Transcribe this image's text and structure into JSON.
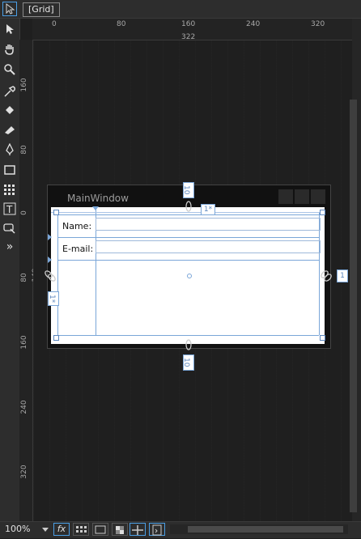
{
  "breadcrumb": {
    "label": "[Grid]"
  },
  "toolbox": {
    "tools": [
      {
        "name": "selection-tool-icon"
      },
      {
        "name": "pan-tool-icon"
      },
      {
        "name": "zoom-tool-icon"
      },
      {
        "name": "eyedropper-tool-icon"
      },
      {
        "name": "paint-bucket-tool-icon"
      },
      {
        "name": "eraser-tool-icon"
      },
      {
        "name": "pen-tool-icon"
      },
      {
        "name": "rectangle-tool-icon"
      },
      {
        "name": "grid-tool-icon"
      },
      {
        "name": "text-tool-icon"
      },
      {
        "name": "shape-tool-icon"
      },
      {
        "name": "expand-tool-icon"
      }
    ],
    "expand_label": "»"
  },
  "rulers": {
    "top": [
      "0",
      "80",
      "160",
      "240",
      "320"
    ],
    "top_span": "322",
    "left": [
      "160",
      "80",
      "0",
      "80",
      "160",
      "240",
      "320"
    ],
    "left_span": "149"
  },
  "window": {
    "title": "MainWindow",
    "margin_top": "10",
    "margin_bottom": "10",
    "column_star": "1*",
    "row_star": "1*",
    "right_label": "1"
  },
  "form": {
    "name_label": "Name:",
    "email_label": "E-mail:"
  },
  "status": {
    "zoom": "100%",
    "fx_label": "fx"
  },
  "colors": {
    "accent": "#4b9fe6",
    "grid_line": "#7aa6d8",
    "background": "#1f1f1f"
  }
}
